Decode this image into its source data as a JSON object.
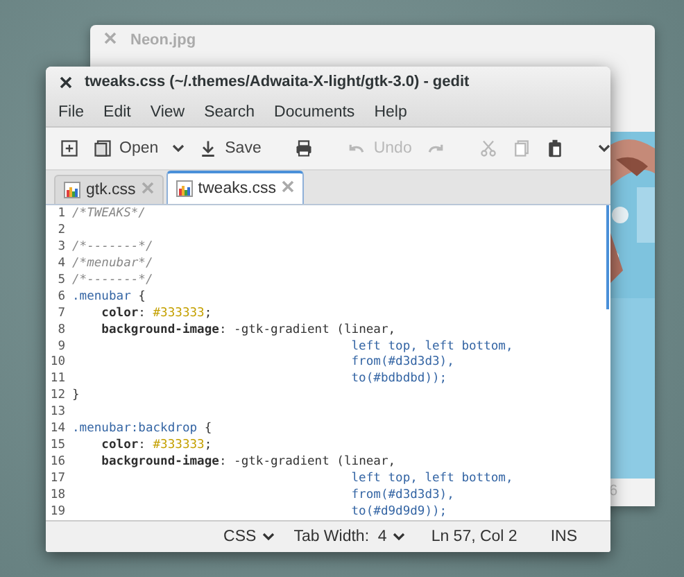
{
  "back_window": {
    "title": "Neon.jpg",
    "status_fragment": "6"
  },
  "window": {
    "title": "tweaks.css (~/.themes/Adwaita-X-light/gtk-3.0) - gedit"
  },
  "menu": [
    "File",
    "Edit",
    "View",
    "Search",
    "Documents",
    "Help"
  ],
  "toolbar": {
    "groups": [
      [
        {
          "disabled": false
        },
        {
          "label": "Open",
          "disabled": false
        },
        {
          "disabled": false
        },
        {
          "label": "Save",
          "disabled": false
        }
      ],
      [
        {
          "disabled": false
        }
      ],
      [
        {
          "label": "Undo",
          "disabled": true
        },
        {
          "disabled": true
        }
      ],
      [
        {
          "disabled": true
        },
        {
          "disabled": true
        },
        {
          "disabled": false
        }
      ],
      [
        {
          "disabled": false
        }
      ]
    ]
  },
  "tabs": [
    {
      "label": "gtk.css",
      "selected": false
    },
    {
      "label": "tweaks.css",
      "selected": true
    }
  ],
  "editor": {
    "lines": [
      {
        "number": "1",
        "tokens": [
          {
            "text": "/*TWEAKS*/",
            "kind": "comment"
          }
        ]
      },
      {
        "number": "2"
      },
      {
        "number": "3",
        "tokens": [
          {
            "text": "/*-------*/",
            "kind": "comment"
          }
        ]
      },
      {
        "number": "4",
        "tokens": [
          {
            "text": "/*menubar*/",
            "kind": "comment"
          }
        ]
      },
      {
        "number": "5",
        "tokens": [
          {
            "text": "/*-------*/",
            "kind": "comment"
          }
        ]
      },
      {
        "number": "6",
        "tokens": [
          {
            "text": ".menubar",
            "kind": "selector"
          },
          {
            "text": " {",
            "kind": "plain"
          }
        ]
      },
      {
        "number": "7",
        "tokens": [
          {
            "text": "    color",
            "kind": "property"
          },
          {
            "text": ":",
            "kind": "plain"
          },
          {
            "text": " #333333",
            "kind": "color"
          },
          {
            "text": ";",
            "kind": "plain"
          }
        ]
      },
      {
        "number": "8",
        "tokens": [
          {
            "text": "    background-image",
            "kind": "property"
          },
          {
            "text": ": -gtk-gradient (linear,",
            "kind": "plain"
          }
        ]
      },
      {
        "number": "9",
        "tokens": [
          {
            "text": "                                      left top, left bottom,",
            "kind": "keyword"
          }
        ]
      },
      {
        "number": "10",
        "tokens": [
          {
            "text": "                                      from(#d3d3d3),",
            "kind": "keyword"
          }
        ]
      },
      {
        "number": "11",
        "tokens": [
          {
            "text": "                                      to(#bdbdbd));",
            "kind": "keyword"
          }
        ]
      },
      {
        "number": "12",
        "tokens": [
          {
            "text": "}",
            "kind": "plain"
          }
        ]
      },
      {
        "number": "13"
      },
      {
        "number": "14",
        "tokens": [
          {
            "text": ".menubar:backdrop",
            "kind": "selector"
          },
          {
            "text": " {",
            "kind": "plain"
          }
        ]
      },
      {
        "number": "15",
        "tokens": [
          {
            "text": "    color",
            "kind": "property"
          },
          {
            "text": ":",
            "kind": "plain"
          },
          {
            "text": " #333333",
            "kind": "color"
          },
          {
            "text": ";",
            "kind": "plain"
          }
        ]
      },
      {
        "number": "16",
        "tokens": [
          {
            "text": "    background-image",
            "kind": "property"
          },
          {
            "text": ": -gtk-gradient (linear,",
            "kind": "plain"
          }
        ]
      },
      {
        "number": "17",
        "tokens": [
          {
            "text": "                                      left top, left bottom,",
            "kind": "keyword"
          }
        ]
      },
      {
        "number": "18",
        "tokens": [
          {
            "text": "                                      from(#d3d3d3),",
            "kind": "keyword"
          }
        ]
      },
      {
        "number": "19",
        "tokens": [
          {
            "text": "                                      to(#d9d9d9));",
            "kind": "keyword"
          }
        ]
      }
    ]
  },
  "status_bar": {
    "language": "CSS",
    "tab_width": "Tab Width:  4",
    "position": "Ln 57, Col 2",
    "mode": "INS"
  }
}
